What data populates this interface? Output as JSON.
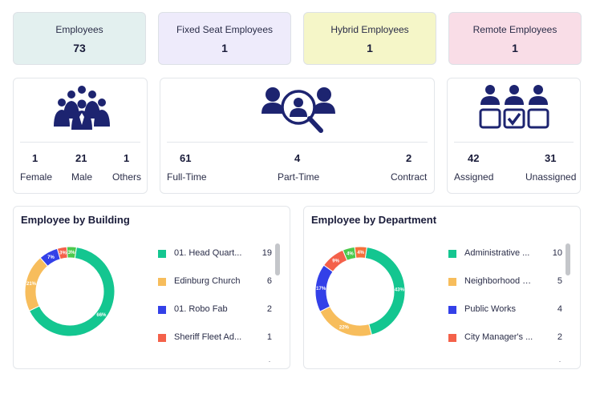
{
  "stat_cards": [
    {
      "label": "Employees",
      "value": "73",
      "bg": "#e3f0ef"
    },
    {
      "label": "Fixed Seat Employees",
      "value": "1",
      "bg": "#eeebfb"
    },
    {
      "label": "Hybrid Employees",
      "value": "1",
      "bg": "#f5f6c8"
    },
    {
      "label": "Remote Employees",
      "value": "1",
      "bg": "#f9dde7"
    }
  ],
  "gender": {
    "icon": "group-icon",
    "items": [
      {
        "value": "1",
        "label": "Female"
      },
      {
        "value": "21",
        "label": "Male"
      },
      {
        "value": "1",
        "label": "Others"
      }
    ]
  },
  "employment": {
    "icon": "search-person-icon",
    "items": [
      {
        "value": "61",
        "label": "Full-Time"
      },
      {
        "value": "4",
        "label": "Part-Time"
      },
      {
        "value": "2",
        "label": "Contract"
      }
    ]
  },
  "assignment": {
    "icon": "assigned-seats-icon",
    "items": [
      {
        "value": "42",
        "label": "Assigned"
      },
      {
        "value": "31",
        "label": "Unassigned"
      }
    ]
  },
  "colors": {
    "navy": "#1d2470",
    "green": "#14c690",
    "yellow": "#f7bd5c",
    "blue": "#3340e8",
    "red": "#f4614a",
    "lime": "#4cc94c"
  },
  "charts": [
    {
      "title": "Employee by Building",
      "chart_data": {
        "type": "pie",
        "series": [
          {
            "label": "01. Head Quarters",
            "display": "01. Head Quart...",
            "value": 19,
            "percent": "66%",
            "color": "#14c690"
          },
          {
            "label": "Edinburg Church",
            "display": "Edinburg Church",
            "value": 6,
            "percent": "21%",
            "color": "#f7bd5c"
          },
          {
            "label": "01. Robo Fab",
            "display": "01. Robo Fab",
            "value": 2,
            "percent": "7%",
            "color": "#3340e8"
          },
          {
            "label": "Sheriff Fleet Ad...",
            "display": "Sheriff Fleet Ad...",
            "value": 1,
            "percent": "3%",
            "color": "#f4614a"
          },
          {
            "label": "",
            "display": "",
            "value": 1,
            "percent": "3%",
            "color": "#4cc94c"
          }
        ]
      }
    },
    {
      "title": "Employee by Department",
      "chart_data": {
        "type": "pie",
        "series": [
          {
            "label": "Administrative",
            "display": "Administrative ...",
            "value": 10,
            "percent": "43%",
            "color": "#14c690"
          },
          {
            "label": "Neighborhood S",
            "display": "Neighborhood S...",
            "value": 5,
            "percent": "22%",
            "color": "#f7bd5c"
          },
          {
            "label": "Public Works",
            "display": "Public Works",
            "value": 4,
            "percent": "17%",
            "color": "#3340e8"
          },
          {
            "label": "City Manager's",
            "display": "City Manager's ...",
            "value": 2,
            "percent": "9%",
            "color": "#f4614a"
          },
          {
            "label": "",
            "display": "",
            "value": 1,
            "percent": "4%",
            "color": "#4cc94c"
          },
          {
            "label": "",
            "display": "",
            "value": 1,
            "percent": "4%",
            "color": "#f5703a"
          }
        ]
      }
    }
  ]
}
